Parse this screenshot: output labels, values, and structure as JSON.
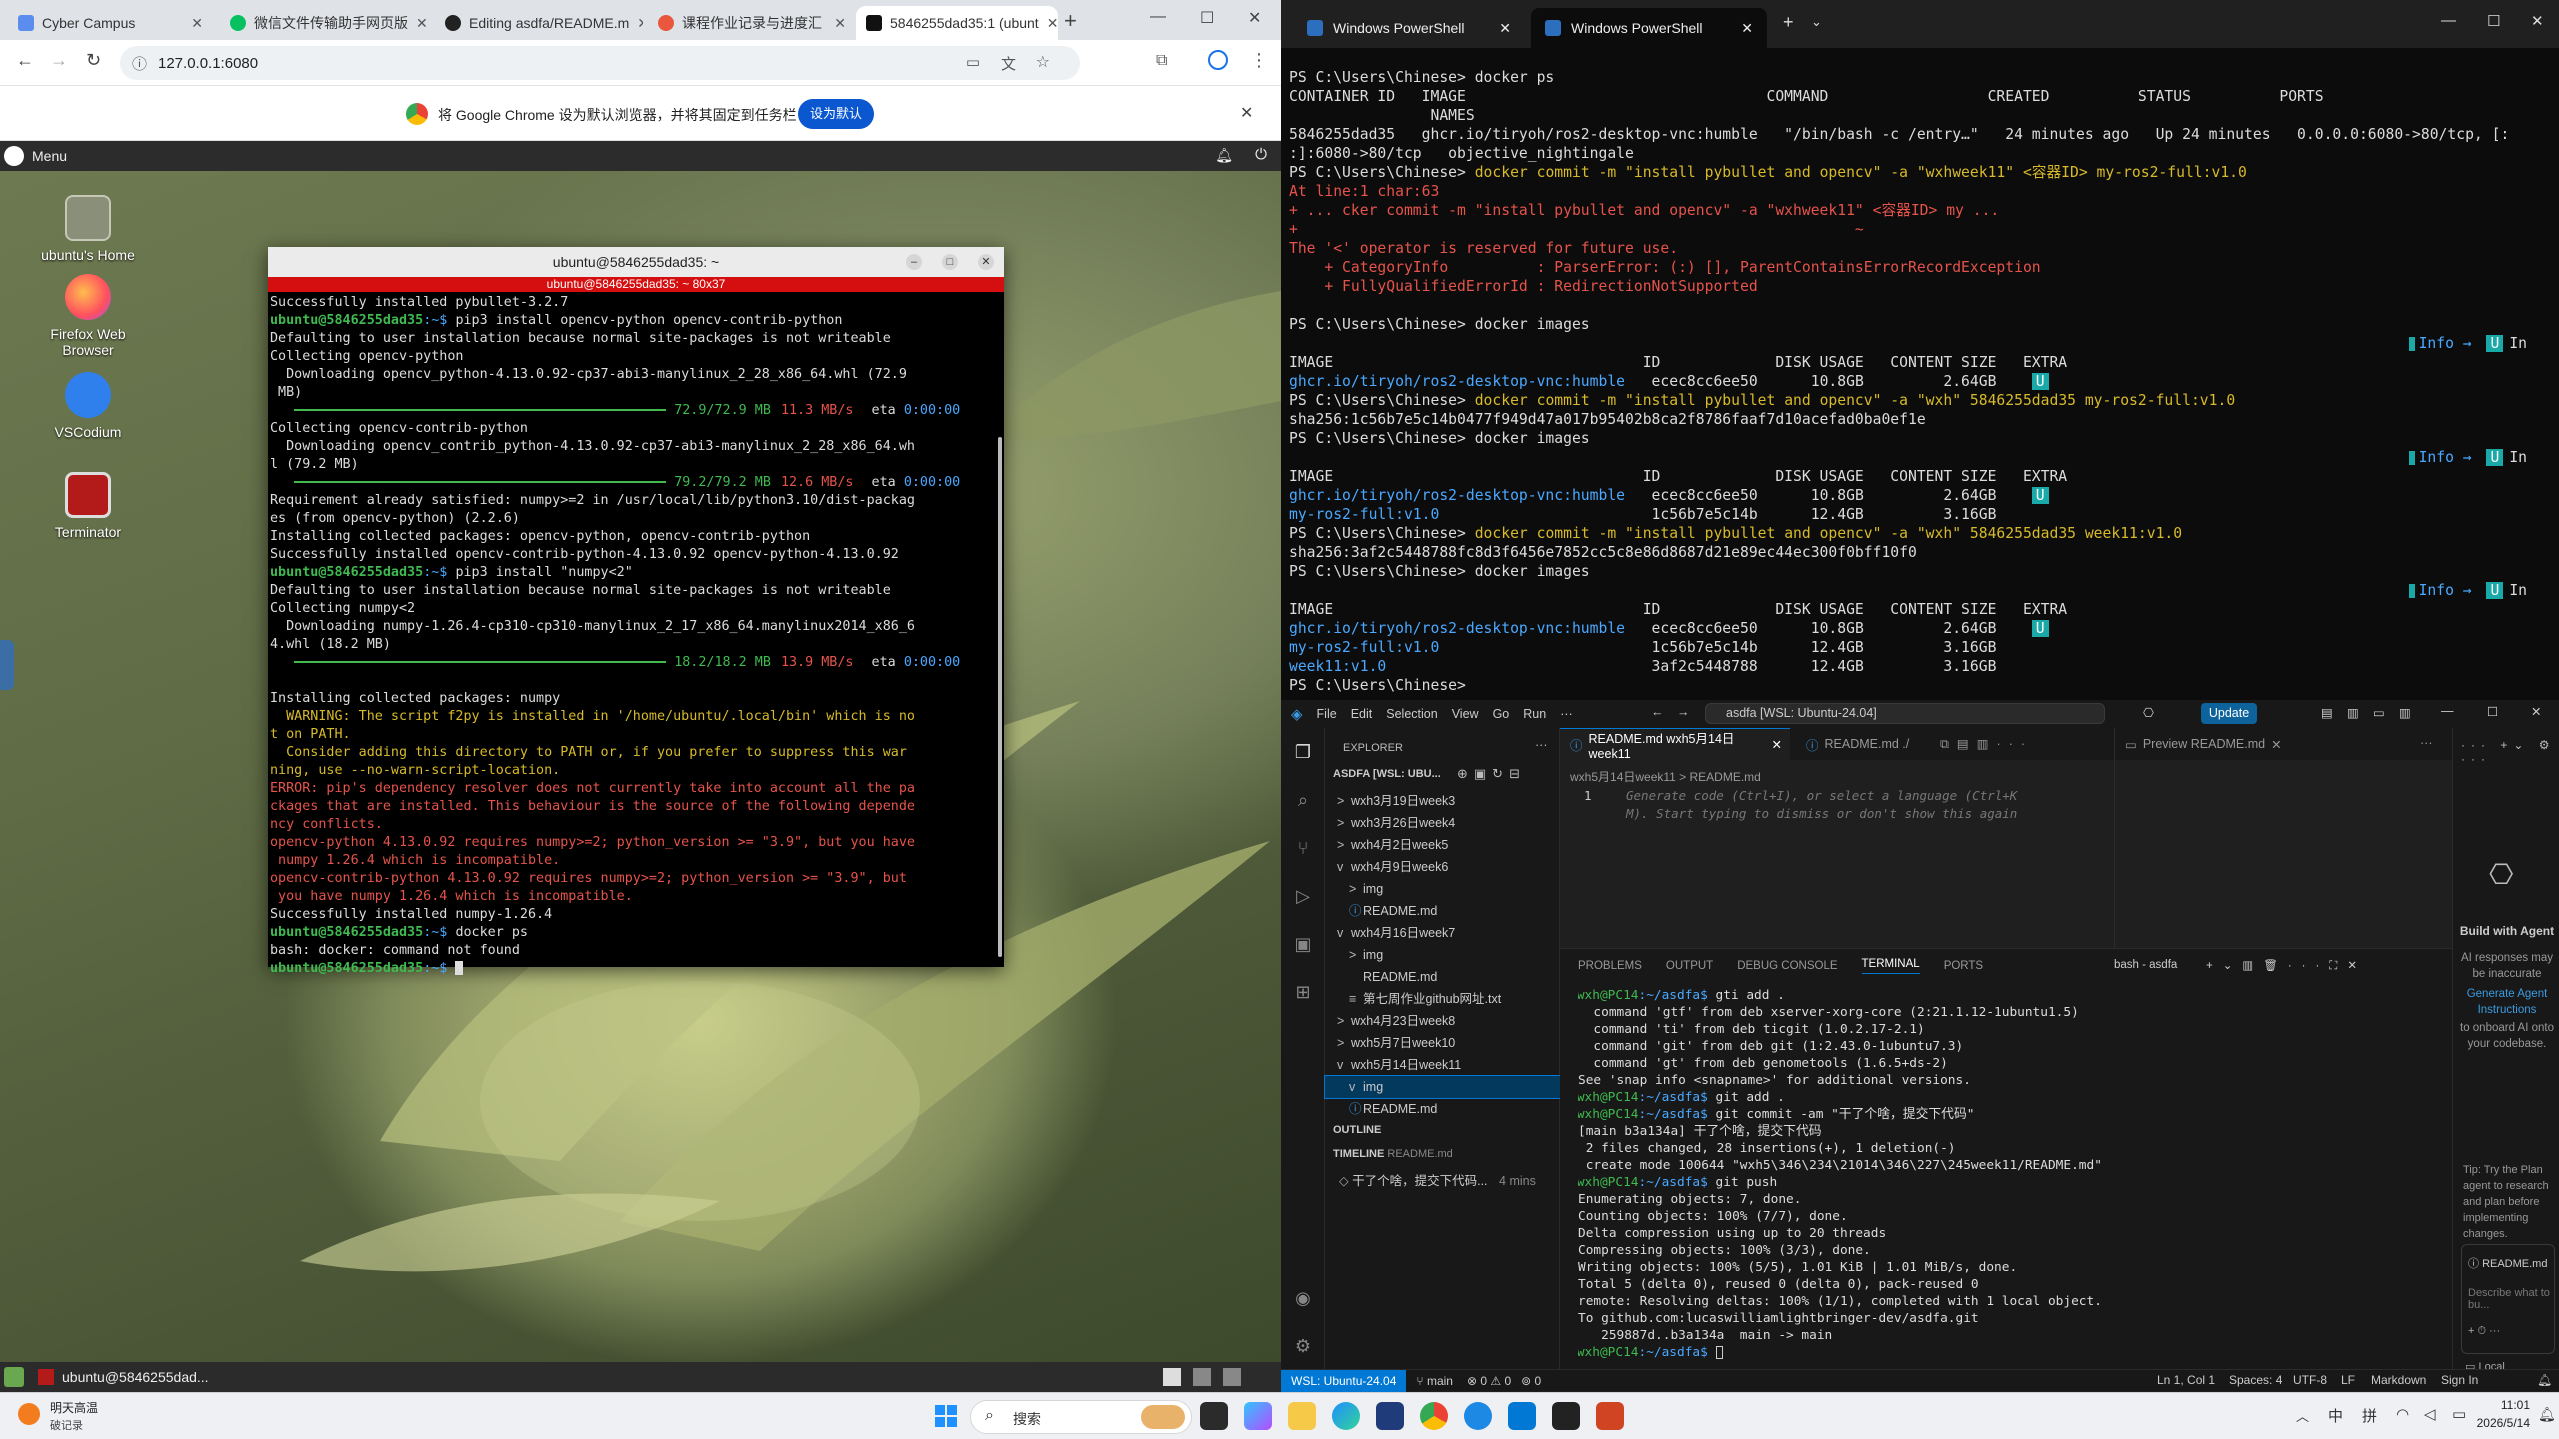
{
  "chrome": {
    "tabs": [
      {
        "label": "Cyber Campus",
        "color": "#5b8def"
      },
      {
        "label": "微信文件传输助手网页版",
        "color": "#07c160"
      },
      {
        "label": "Editing asdfa/README.m",
        "color": "#222222"
      },
      {
        "label": "课程作业记录与进度汇",
        "color": "#e9573f"
      },
      {
        "label": "5846255dad35:1 (ubunt",
        "color": "#111111"
      }
    ],
    "url": "127.0.0.1:6080",
    "infobar_text": "将 Google Chrome 设为默认浏览器，并将其固定到任务栏",
    "infobar_button": "设为默认"
  },
  "desktop": {
    "menu_label": "Menu",
    "icons": [
      {
        "label": "ubuntu's Home"
      },
      {
        "label": "Firefox Web Browser"
      },
      {
        "label": "VSCodium"
      },
      {
        "label": "Terminator"
      }
    ],
    "taskbar_item": "ubuntu@5846255dad..."
  },
  "terminal": {
    "title": "ubuntu@5846255dad35: ~",
    "subtitle": "ubuntu@5846255dad35: ~ 80x37",
    "lines": [
      {
        "t": "Successfully installed pybullet-3.2.7",
        "c": "w"
      },
      {
        "p": "ubuntu@5846255dad35",
        "d": ":~$ ",
        "t": "pip3 install opencv-python opencv-contrib-python"
      },
      {
        "t": "Defaulting to user installation because normal site-packages is not writeable",
        "c": "w"
      },
      {
        "t": "Collecting opencv-python",
        "c": "w"
      },
      {
        "t": "  Downloading opencv_python-4.13.0.92-cp37-abi3-manylinux_2_28_x86_64.whl (72.9",
        "c": "w"
      },
      {
        "t": " MB)",
        "c": "w"
      },
      {
        "bar": "72.9/72.9 MB",
        "speed": "11.3 MB/s",
        "eta": "0:00:00"
      },
      {
        "t": "Collecting opencv-contrib-python",
        "c": "w"
      },
      {
        "t": "  Downloading opencv_contrib_python-4.13.0.92-cp37-abi3-manylinux_2_28_x86_64.wh",
        "c": "w"
      },
      {
        "t": "l (79.2 MB)",
        "c": "w"
      },
      {
        "bar": "79.2/79.2 MB",
        "speed": "12.6 MB/s",
        "eta": "0:00:00"
      },
      {
        "t": "Requirement already satisfied: numpy>=2 in /usr/local/lib/python3.10/dist-packag",
        "c": "w"
      },
      {
        "t": "es (from opencv-python) (2.2.6)",
        "c": "w"
      },
      {
        "t": "Installing collected packages: opencv-python, opencv-contrib-python",
        "c": "w"
      },
      {
        "t": "Successfully installed opencv-contrib-python-4.13.0.92 opencv-python-4.13.0.92",
        "c": "w"
      },
      {
        "p": "ubuntu@5846255dad35",
        "d": ":~$ ",
        "t": "pip3 install \"numpy<2\""
      },
      {
        "t": "Defaulting to user installation because normal site-packages is not writeable",
        "c": "w"
      },
      {
        "t": "Collecting numpy<2",
        "c": "w"
      },
      {
        "t": "  Downloading numpy-1.26.4-cp310-cp310-manylinux_2_17_x86_64.manylinux2014_x86_6",
        "c": "w"
      },
      {
        "t": "4.whl (18.2 MB)",
        "c": "w"
      },
      {
        "bar": "18.2/18.2 MB",
        "speed": "13.9 MB/s",
        "eta": "0:00:00"
      },
      {
        "t": "",
        "c": "w"
      },
      {
        "t": "Installing collected packages: numpy",
        "c": "w"
      },
      {
        "t": "  WARNING: The script f2py is installed in '/home/ubuntu/.local/bin' which is no",
        "c": "y"
      },
      {
        "t": "t on PATH.",
        "c": "y"
      },
      {
        "t": "  Consider adding this directory to PATH or, if you prefer to suppress this war",
        "c": "y"
      },
      {
        "t": "ning, use --no-warn-script-location.",
        "c": "y"
      },
      {
        "t": "ERROR: pip's dependency resolver does not currently take into account all the pa",
        "c": "r"
      },
      {
        "t": "ckages that are installed. This behaviour is the source of the following depende",
        "c": "r"
      },
      {
        "t": "ncy conflicts.",
        "c": "r"
      },
      {
        "t": "opencv-python 4.13.0.92 requires numpy>=2; python_version >= \"3.9\", but you have",
        "c": "r"
      },
      {
        "t": " numpy 1.26.4 which is incompatible.",
        "c": "r"
      },
      {
        "t": "opencv-contrib-python 4.13.0.92 requires numpy>=2; python_version >= \"3.9\", but",
        "c": "r"
      },
      {
        "t": " you have numpy 1.26.4 which is incompatible.",
        "c": "r"
      },
      {
        "t": "Successfully installed numpy-1.26.4",
        "c": "w"
      },
      {
        "p": "ubuntu@5846255dad35",
        "d": ":~$ ",
        "t": "docker ps"
      },
      {
        "t": "bash: docker: command not found",
        "c": "w"
      },
      {
        "p": "ubuntu@5846255dad35",
        "d": ":~$ ",
        "t": ""
      }
    ]
  },
  "powershell": {
    "tabs": [
      "Windows PowerShell",
      "Windows PowerShell"
    ],
    "lines": [
      {
        "t": "PS C:\\Users\\Chinese> docker ps",
        "c": "w"
      },
      {
        "t": "CONTAINER ID   IMAGE                                  COMMAND                  CREATED          STATUS          PORTS",
        "c": "w"
      },
      {
        "t": "                NAMES",
        "c": "w"
      },
      {
        "t": "5846255dad35   ghcr.io/tiryoh/ros2-desktop-vnc:humble   \"/bin/bash -c /entry…\"   24 minutes ago   Up 24 minutes   0.0.0.0:6080->80/tcp, [:",
        "c": "w"
      },
      {
        "t": ":]:6080->80/tcp   objective_nightingale",
        "c": "w"
      },
      {
        "t": "PS C:\\Users\\Chinese> docker commit -m \"install pybullet and opencv\" -a \"wxhweek11\" <容器ID> my-ros2-full:v1.0",
        "c": "cmd"
      },
      {
        "t": "At line:1 char:63",
        "c": "r"
      },
      {
        "t": "+ ... cker commit -m \"install pybullet and opencv\" -a \"wxhweek11\" <容器ID> my ...",
        "c": "r"
      },
      {
        "t": "+                                                               ~",
        "c": "r"
      },
      {
        "t": "The '<' operator is reserved for future use.",
        "c": "r"
      },
      {
        "t": "    + CategoryInfo          : ParserError: (:) [], ParentContainsErrorRecordException",
        "c": "r"
      },
      {
        "t": "    + FullyQualifiedErrorId : RedirectionNotSupported",
        "c": "r"
      },
      {
        "t": "",
        "c": "w"
      },
      {
        "t": "PS C:\\Users\\Chinese> docker images",
        "c": "w"
      },
      {
        "t": "",
        "c": "w",
        "badge": true
      },
      {
        "t": "IMAGE                                   ID             DISK USAGE   CONTENT SIZE   EXTRA",
        "c": "w"
      },
      {
        "t": "ghcr.io/tiryoh/ros2-desktop-vnc:humble   ecec8cc6ee50      10.8GB         2.64GB    U ",
        "c": "img"
      },
      {
        "t": "PS C:\\Users\\Chinese> docker commit -m \"install pybullet and opencv\" -a \"wxh\" 5846255dad35 my-ros2-full:v1.0",
        "c": "cmd"
      },
      {
        "t": "sha256:1c56b7e5c14b0477f949d47a017b95402b8ca2f8786faaf7d10acefad0ba0ef1e",
        "c": "w"
      },
      {
        "t": "PS C:\\Users\\Chinese> docker images",
        "c": "w"
      },
      {
        "t": "",
        "c": "w",
        "badge": true
      },
      {
        "t": "IMAGE                                   ID             DISK USAGE   CONTENT SIZE   EXTRA",
        "c": "w"
      },
      {
        "t": "ghcr.io/tiryoh/ros2-desktop-vnc:humble   ecec8cc6ee50      10.8GB         2.64GB    U ",
        "c": "img"
      },
      {
        "t": "my-ros2-full:v1.0                        1c56b7e5c14b      12.4GB         3.16GB",
        "c": "img"
      },
      {
        "t": "PS C:\\Users\\Chinese> docker commit -m \"install pybullet and opencv\" -a \"wxh\" 5846255dad35 week11:v1.0",
        "c": "cmd"
      },
      {
        "t": "sha256:3af2c5448788fc8d3f6456e7852cc5c8e86d8687d21e89ec44ec300f0bff10f0",
        "c": "w"
      },
      {
        "t": "PS C:\\Users\\Chinese> docker images",
        "c": "w"
      },
      {
        "t": "",
        "c": "w",
        "badge": true
      },
      {
        "t": "IMAGE                                   ID             DISK USAGE   CONTENT SIZE   EXTRA",
        "c": "w"
      },
      {
        "t": "ghcr.io/tiryoh/ros2-desktop-vnc:humble   ecec8cc6ee50      10.8GB         2.64GB    U ",
        "c": "img"
      },
      {
        "t": "my-ros2-full:v1.0                        1c56b7e5c14b      12.4GB         3.16GB",
        "c": "img"
      },
      {
        "t": "week11:v1.0                              3af2c5448788      12.4GB         3.16GB",
        "c": "img"
      },
      {
        "t": "PS C:\\Users\\Chinese>",
        "c": "w"
      }
    ],
    "badge_text": "Info →  U  In Use"
  },
  "vscode": {
    "menu": [
      "File",
      "Edit",
      "Selection",
      "View",
      "Go",
      "Run",
      "···"
    ],
    "search": "asdfa [WSL: Ubuntu-24.04]",
    "update": "Update",
    "explorer_title": "EXPLORER",
    "workspace": "ASDFA [WSL: UBU...",
    "tree": [
      {
        "label": "wxh3月19日week3",
        "depth": 0,
        "caret": ">"
      },
      {
        "label": "wxh3月26日week4",
        "depth": 0,
        "caret": ">"
      },
      {
        "label": "wxh4月2日week5",
        "depth": 0,
        "caret": ">"
      },
      {
        "label": "wxh4月9日week6",
        "depth": 0,
        "caret": "v"
      },
      {
        "label": "img",
        "depth": 1,
        "caret": ">"
      },
      {
        "label": "README.md",
        "depth": 1,
        "caret": "ⓘ"
      },
      {
        "label": "wxh4月16日week7",
        "depth": 0,
        "caret": "v"
      },
      {
        "label": "img",
        "depth": 1,
        "caret": ">"
      },
      {
        "label": "README.md",
        "depth": 1,
        "caret": " "
      },
      {
        "label": "第七周作业github网址.txt",
        "depth": 1,
        "caret": "≡"
      },
      {
        "label": "wxh4月23日week8",
        "depth": 0,
        "caret": ">"
      },
      {
        "label": "wxh5月7日week10",
        "depth": 0,
        "caret": ">"
      },
      {
        "label": "wxh5月14日week11",
        "depth": 0,
        "caret": "v"
      },
      {
        "label": "img",
        "depth": 1,
        "caret": "v"
      },
      {
        "label": "README.md",
        "depth": 1,
        "caret": "ⓘ"
      }
    ],
    "outline": "OUTLINE",
    "timeline": "TIMELINE",
    "timeline_file": "README.md",
    "timeline_entry": "干了个啥，提交下代码...",
    "timeline_time": "4 mins",
    "editor_tabs": [
      "README.md  wxh5月14日week11",
      "README.md ./",
      "Preview README.md"
    ],
    "breadcrumb": "wxh5月14日week11  >  README.md",
    "editor_hint1": "Generate code (Ctrl+I), or select a language (Ctrl+K",
    "editor_hint2": "M). Start typing to dismiss or don't show this again",
    "panel_tabs": [
      "PROBLEMS",
      "OUTPUT",
      "DEBUG CONSOLE",
      "TERMINAL",
      "PORTS"
    ],
    "panel_shell": "bash - asdfa",
    "term": [
      {
        "t": "wxh@PC14:~/asdfa$ gti add .",
        "p": true
      },
      {
        "t": "  command 'gtf' from deb xserver-xorg-core (2:21.1.12-1ubuntu1.5)"
      },
      {
        "t": "  command 'ti' from deb ticgit (1.0.2.17-2.1)"
      },
      {
        "t": "  command 'git' from deb git (1:2.43.0-1ubuntu7.3)"
      },
      {
        "t": "  command 'gt' from deb genometools (1.6.5+ds-2)"
      },
      {
        "t": "See 'snap info <snapname>' for additional versions."
      },
      {
        "t": "wxh@PC14:~/asdfa$ git add .",
        "p": true
      },
      {
        "t": "wxh@PC14:~/asdfa$ git commit -am \"干了个啥，提交下代码\"",
        "p": true
      },
      {
        "t": "[main b3a134a] 干了个啥，提交下代码"
      },
      {
        "t": " 2 files changed, 28 insertions(+), 1 deletion(-)"
      },
      {
        "t": " create mode 100644 \"wxh5\\346\\234\\21014\\346\\227\\245week11/README.md\""
      },
      {
        "t": "wxh@PC14:~/asdfa$ git push",
        "p": true
      },
      {
        "t": "Enumerating objects: 7, done."
      },
      {
        "t": "Counting objects: 100% (7/7), done."
      },
      {
        "t": "Delta compression using up to 20 threads"
      },
      {
        "t": "Compressing objects: 100% (3/3), done."
      },
      {
        "t": "Writing objects: 100% (5/5), 1.01 KiB | 1.01 MiB/s, done."
      },
      {
        "t": "Total 5 (delta 0), reused 0 (delta 0), pack-reused 0"
      },
      {
        "t": "remote: Resolving deltas: 100% (1/1), completed with 1 local object."
      },
      {
        "t": "To github.com:lucaswilliamlightbringer-dev/asdfa.git"
      },
      {
        "t": "   259887d..b3a134a  main -> main"
      },
      {
        "t": "wxh@PC14:~/asdfa$ ",
        "p": true
      }
    ],
    "chat_title": "Build with Agent",
    "chat_body": "AI responses may be inaccurate",
    "chat_link": "Generate Agent Instructions",
    "chat_body2": "to onboard AI onto your codebase.",
    "chat_tip": "Tip: Try the Plan agent to research and plan before implementing changes.",
    "chat_file": "README.md",
    "chat_input": "Describe what to bu...",
    "chat_local": "Local",
    "status_left": "WSL: Ubuntu-24.04",
    "status_branch": "main",
    "status_err": "⊗ 0 ⚠ 0",
    "status_ports": "0",
    "status_right": [
      "Ln 1, Col 1",
      "Spaces: 4",
      "UTF-8",
      "LF",
      "Markdown",
      "Sign In"
    ]
  },
  "taskbar": {
    "weather_line1": "明天高温",
    "weather_line2": "破记录",
    "search": "搜索",
    "time": "11:01",
    "date": "2026/5/14",
    "ime": [
      "中",
      "拼"
    ]
  }
}
